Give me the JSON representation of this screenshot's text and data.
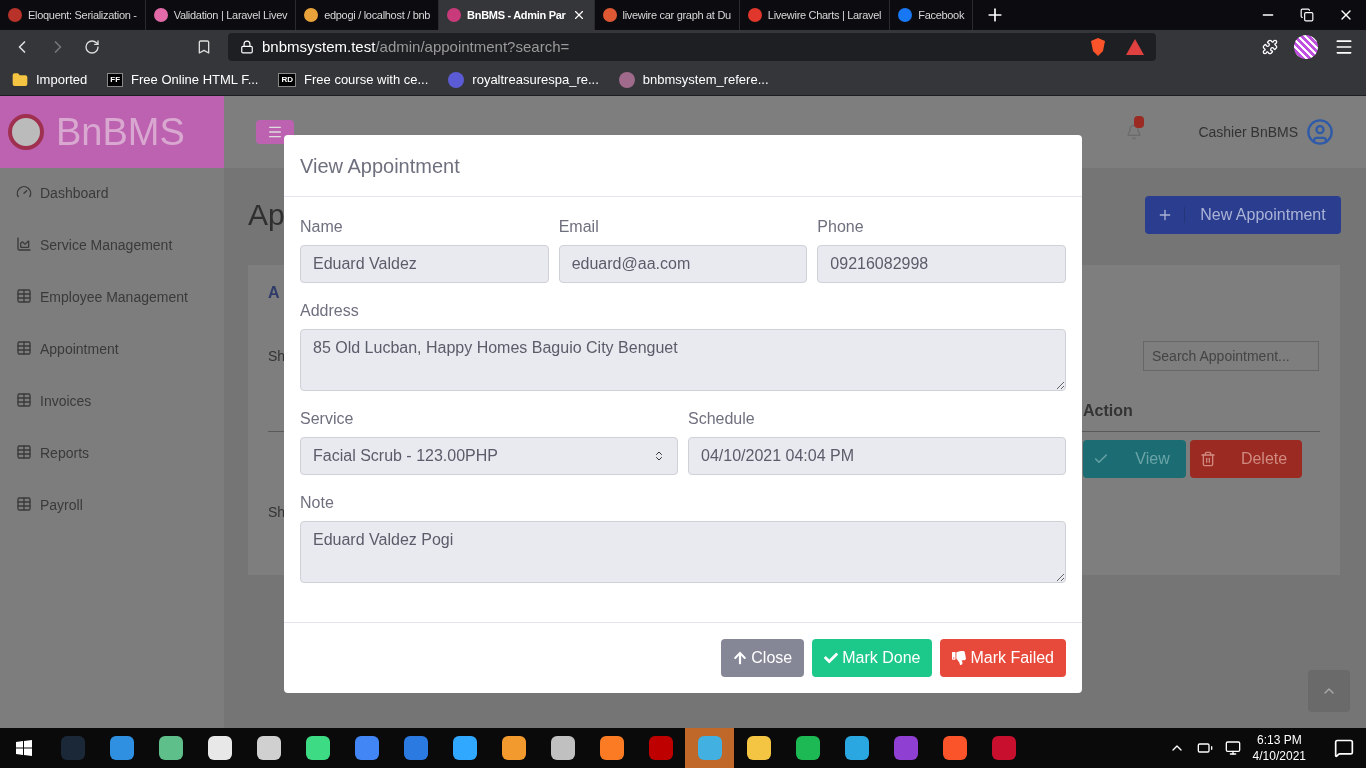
{
  "browser": {
    "tabs": [
      {
        "title": "Eloquent: Serialization -",
        "selected": false,
        "color": "#b8322a"
      },
      {
        "title": "Validation | Laravel Livev",
        "selected": false,
        "color": "#e26aa8"
      },
      {
        "title": "edpogi / localhost / bnb",
        "selected": false,
        "color": "#e8a33a"
      },
      {
        "title": "BnBMS - Admin Par",
        "selected": true,
        "color": "#c93a7a"
      },
      {
        "title": "livewire car graph at Du",
        "selected": false,
        "color": "#de5833"
      },
      {
        "title": "Livewire Charts | Laravel",
        "selected": false,
        "color": "#e0362b"
      },
      {
        "title": "Facebook",
        "selected": false,
        "color": "#1877f2"
      }
    ],
    "url_host": "bnbmsystem.test",
    "url_path": "/admin/appointment?search=",
    "bookmarks": [
      {
        "kind": "folder",
        "label": "Imported"
      },
      {
        "kind": "badge",
        "badge": "FF",
        "label": "Free Online HTML F..."
      },
      {
        "kind": "badge",
        "badge": "RD",
        "label": "Free course with ce..."
      },
      {
        "kind": "site",
        "label": "royaltreasurespa_re...",
        "color": "#5b5bd6"
      },
      {
        "kind": "site",
        "label": "bnbmsystem_refere...",
        "color": "#a06a8c"
      }
    ]
  },
  "app": {
    "brand": "BnBMS",
    "user": "Cashier BnBMS",
    "sidebar": [
      {
        "label": "Dashboard",
        "kind": "gauge"
      },
      {
        "label": "Service Management",
        "kind": "chart"
      },
      {
        "label": "Employee Management",
        "kind": "table"
      },
      {
        "label": "Appointment",
        "kind": "table"
      },
      {
        "label": "Invoices",
        "kind": "table"
      },
      {
        "label": "Reports",
        "kind": "table"
      },
      {
        "label": "Payroll",
        "kind": "table"
      }
    ],
    "page_title": "Ap",
    "new_button": "New Appointment",
    "card_title": "A",
    "show_text": "Sh",
    "search_placeholder": "Search Appointment...",
    "action_header": "Action",
    "view_button": "View",
    "delete_button": "Delete",
    "footer_text": "Sh"
  },
  "modal": {
    "title": "View Appointment",
    "rows": [
      [
        {
          "label": "Name",
          "value": "Eduard Valdez",
          "kind": "input"
        },
        {
          "label": "Email",
          "value": "eduard@aa.com",
          "kind": "input"
        },
        {
          "label": "Phone",
          "value": "09216082998",
          "kind": "input"
        }
      ],
      [
        {
          "label": "Address",
          "value": "85 Old Lucban, Happy Homes Baguio City Benguet",
          "kind": "textarea"
        }
      ],
      [
        {
          "label": "Service",
          "value": "Facial Scrub - 123.00PHP",
          "kind": "select"
        },
        {
          "label": "Schedule",
          "value": "04/10/2021 04:04 PM",
          "kind": "input"
        }
      ],
      [
        {
          "label": "Note",
          "value": "Eduard Valdez Pogi",
          "kind": "textarea"
        }
      ]
    ],
    "buttons": [
      {
        "label": "Close",
        "kind": "close"
      },
      {
        "label": "Mark Done",
        "kind": "done"
      },
      {
        "label": "Mark Failed",
        "kind": "failed"
      }
    ]
  },
  "taskbar": {
    "apps": [
      {
        "color": "#1b2838",
        "selected": false
      },
      {
        "color": "#2f8fe0",
        "selected": false
      },
      {
        "color": "#5fbf8a",
        "selected": false
      },
      {
        "color": "#e8e8e8",
        "selected": false
      },
      {
        "color": "#d0d0d0",
        "selected": false
      },
      {
        "color": "#3ddc84",
        "selected": false
      },
      {
        "color": "#4285f4",
        "selected": false
      },
      {
        "color": "#2a7ae2",
        "selected": false
      },
      {
        "color": "#31a8ff",
        "selected": false
      },
      {
        "color": "#f29a2e",
        "selected": false
      },
      {
        "color": "#c0c0c0",
        "selected": false
      },
      {
        "color": "#fb7a24",
        "selected": false
      },
      {
        "color": "#bf0000",
        "selected": false
      },
      {
        "color": "#42b0e0",
        "selected": true
      },
      {
        "color": "#f4c542",
        "selected": false
      },
      {
        "color": "#1db954",
        "selected": false
      },
      {
        "color": "#2aa7e0",
        "selected": false
      },
      {
        "color": "#8f3fd1",
        "selected": false
      },
      {
        "color": "#fb542b",
        "selected": false
      },
      {
        "color": "#c8102e",
        "selected": false
      }
    ],
    "time": "6:13 PM",
    "date": "4/10/2021"
  }
}
